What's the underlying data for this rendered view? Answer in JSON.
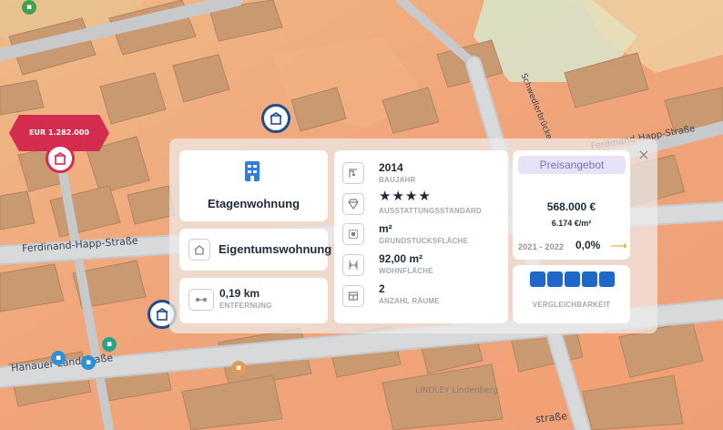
{
  "map": {
    "price_marker": "EUR 1.282.000",
    "street_labels": {
      "ferdinand_left": "Ferdinand-Happ-Straße",
      "ferdinand_right": "Ferdinand-Happ-Straße",
      "schwedler": "Schwedlerbrücke",
      "hanauer": "Hanauer Landstraße",
      "bottom_right": "straße",
      "lindley": "LINDLEY Lindenberg",
      "faint": "Ha"
    }
  },
  "card": {
    "close_icon": "×",
    "type_label": "Etagenwohnung",
    "ownership_label": "Eigentumswohnung",
    "distance_value": "0,19 km",
    "distance_caption": "ENTFERNUNG",
    "attributes": [
      {
        "icon": "building-crane-icon",
        "value": "2014",
        "caption": "BAUJAHR"
      },
      {
        "icon": "diamond-icon",
        "value": "★★★★",
        "caption": "AUSSTATTUNGSSTANDARD"
      },
      {
        "icon": "plot-area-icon",
        "value": "m²",
        "caption": "GRUNDSTÜCKSFLÄCHE"
      },
      {
        "icon": "floor-area-icon",
        "value": "92,00 m²",
        "caption": "WOHNFLÄCHE"
      },
      {
        "icon": "rooms-icon",
        "value": "2",
        "caption": "ANZAHL RÄUME"
      }
    ],
    "price": {
      "badge": "Preisangebot",
      "value": "568.000 €",
      "per_sqm": "6.174 €/m²",
      "period": "2021 - 2022",
      "change": "0,0%",
      "trend_color": "#f2a516"
    },
    "comparability": {
      "level": 5,
      "max": 5,
      "caption": "VERGLEICHBARKEIT",
      "color": "#1f68c9"
    }
  },
  "colors": {
    "price_marker": "#d42c4f",
    "marker_border": "#1e4e8c",
    "badge_bg": "#e7e2f6",
    "badge_text": "#7b74b8"
  }
}
